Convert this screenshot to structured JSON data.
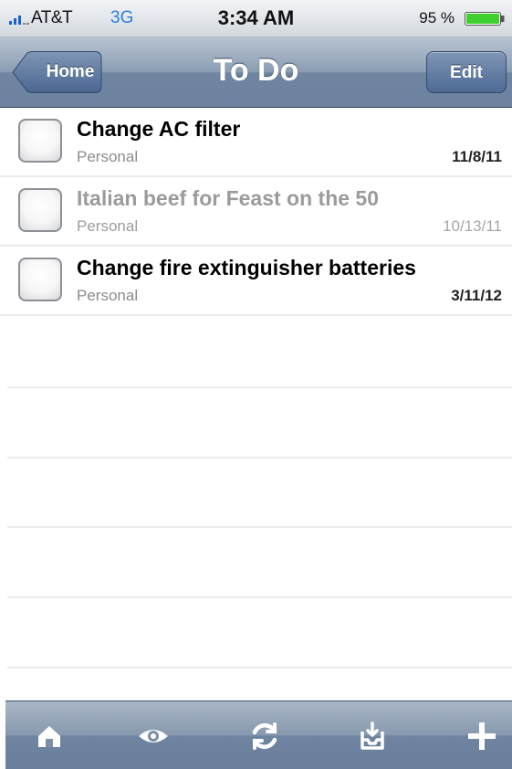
{
  "status_bar": {
    "carrier": "AT&T",
    "network": "3G",
    "time": "3:34 AM",
    "battery_percent": "95 %"
  },
  "nav_bar": {
    "title": "To Do",
    "back_label": "Home",
    "edit_label": "Edit"
  },
  "tasks": [
    {
      "title": "Change AC filter",
      "category": "Personal",
      "date": "11/8/11",
      "completed": false
    },
    {
      "title": "Italian beef for Feast on the 50",
      "category": "Personal",
      "date": "10/13/11",
      "completed": true
    },
    {
      "title": "Change fire extinguisher batteries",
      "category": "Personal",
      "date": "3/11/12",
      "completed": false
    }
  ],
  "toolbar": {
    "icons": [
      "home-icon",
      "eye-icon",
      "sync-icon",
      "inbox-icon",
      "plus-icon"
    ]
  },
  "colors": {
    "nav_bar": "#7d91aa",
    "network_text": "#2b7fe0",
    "battery_fill": "#3fcf2f",
    "completed_text": "#9b9b9b"
  }
}
